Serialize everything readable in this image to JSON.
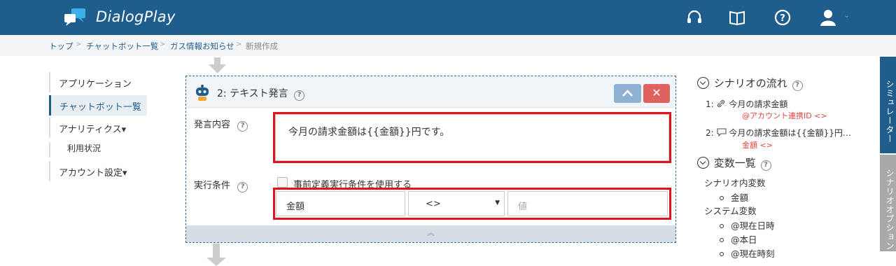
{
  "app": {
    "name": "DialogPlay"
  },
  "header": {
    "icons": [
      "headset-icon",
      "book-icon",
      "help-icon",
      "user-icon"
    ],
    "user_caret": "⌄"
  },
  "breadcrumb": {
    "items": [
      "トップ",
      "チャットボット一覧",
      "ガス情報お知らせ",
      "新規作成"
    ],
    "sep": ">"
  },
  "sidebar": {
    "items": [
      {
        "label": "アプリケーション"
      },
      {
        "label": "チャットボット一覧",
        "active": true
      },
      {
        "label": "アナリティクス▾"
      },
      {
        "label": "利用状況"
      },
      {
        "label": "アカウント設定▾"
      }
    ]
  },
  "card": {
    "title": "2: テキスト発言",
    "help": "?",
    "close": "✕",
    "message_label": "発言内容",
    "message_value": "今月の請求金額は{{金額}}円です。",
    "condition_label": "実行条件",
    "checkbox_label": "事前定義実行条件を使用する",
    "cond_variable": "金額",
    "cond_operator": "<>",
    "cond_value_placeholder": "値",
    "footer_chevron": "︽"
  },
  "flow": {
    "title": "シナリオの流れ",
    "items": [
      {
        "num": "1:",
        "text": "今月の請求金額",
        "sub": "@アカウント連携ID <>"
      },
      {
        "num": "2:",
        "text": "今月の請求金額は{{金額}}円…",
        "sub": "金額 <>"
      }
    ]
  },
  "variables": {
    "title": "変数一覧",
    "scenario_title": "シナリオ内変数",
    "scenario_vars": [
      "金額"
    ],
    "system_title": "システム変数",
    "system_vars": [
      "@現在日時",
      "@本日",
      "@現在時刻"
    ]
  },
  "side_tabs": {
    "simulator": "シミュレーター",
    "options": "シナリオオプション"
  },
  "colors": {
    "header": "#1f5d8c",
    "accent_red": "#e0141e",
    "close_btn": "#e0625f",
    "up_btn": "#8fb1d3"
  }
}
